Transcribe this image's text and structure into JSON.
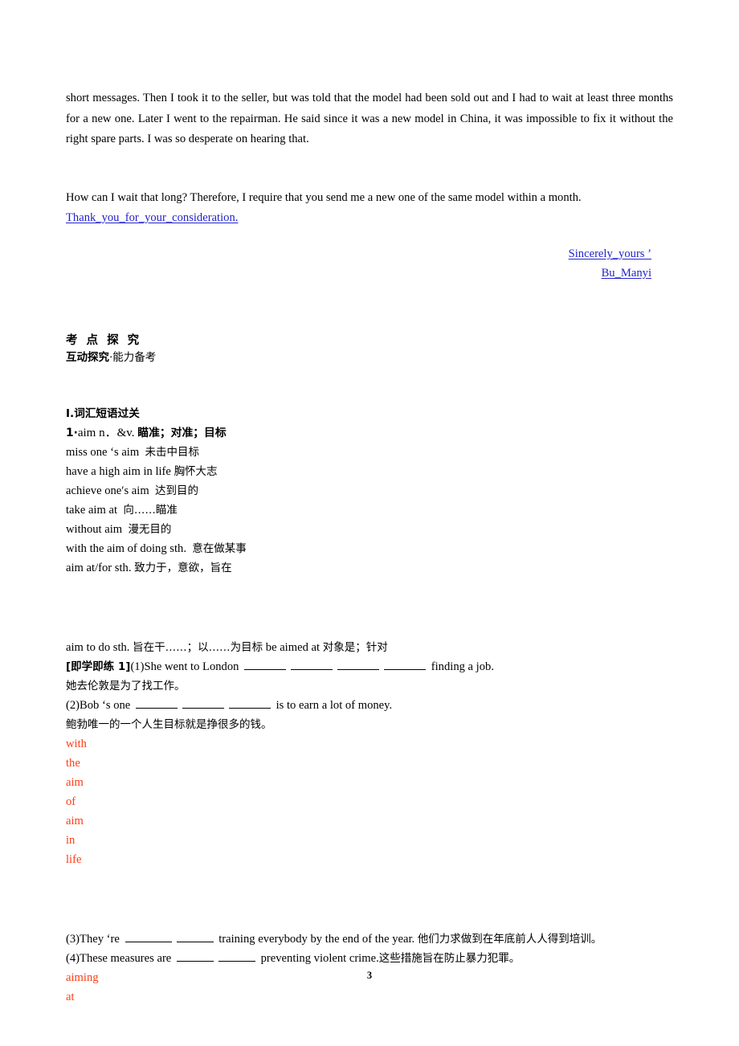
{
  "letter": {
    "paragraph1": "short messages. Then I took it to the seller, but was told that the model had been sold out and I had to wait at least three months for a new one. Later I went to the repairman. He said since it was a new model in China, it was impossible to fix it without the right spare parts. I was so desperate on hearing that.",
    "paragraph2": "How can I wait that long? Therefore, I require that you send me a new one of the same model within a month.",
    "closing_link": "Thank_you_for_your_consideration.",
    "signoff": "Sincerely_yours ’",
    "signature": "Bu_Manyi",
    "link_color": "#2222cc"
  },
  "section": {
    "title": "考 点 探 究",
    "subtitle_bold": "互动探究",
    "subtitle_regular": "·能力备考"
  },
  "vocab": {
    "heading": "Ⅰ.词汇短语过关",
    "entry_number": "1·",
    "entry_word": "aim n．&v.",
    "entry_meaning": "瞄准；对准；目标",
    "phrases": [
      {
        "en": "miss one ‘s aim",
        "cn": "未击中目标"
      },
      {
        "en": "have a high aim in life",
        "cn": "胸怀大志"
      },
      {
        "en": "achieve one′s aim",
        "cn": "达到目的"
      },
      {
        "en": "take aim at",
        "cn": "向……瞄准"
      },
      {
        "en": "without aim",
        "cn": "漫无目的"
      },
      {
        "en": "with the aim of doing sth.",
        "cn": "意在做某事"
      },
      {
        "en": "aim at/for sth.",
        "cn": "致力于，意欲，旨在"
      }
    ],
    "phrase_extra": {
      "en1": "aim to do sth.",
      "cn1": "旨在干……；以……为目标",
      "en2": "be aimed at",
      "cn2": "对象是；针对"
    }
  },
  "exercise": {
    "tag": "[即学即练 1]",
    "items": [
      {
        "number": "(1)",
        "text_before": "She went to London",
        "blanks": 4,
        "text_after": "finding a job.",
        "translation": "她去伦敦是为了找工作。"
      },
      {
        "number": "(2)",
        "text_before": "Bob ‘s one",
        "blanks": 3,
        "text_after": "is to earn a lot of money.",
        "translation": "鲍勃唯一的一个人生目标就是挣很多的钱。"
      },
      {
        "number": "(3)",
        "text_before": "They ‘re",
        "blanks": 2,
        "text_after": "training everybody by the end of the year.",
        "translation": "他们力求做到在年底前人人得到培训。"
      },
      {
        "number": "(4)",
        "text_before": "These measures are",
        "blanks": 2,
        "text_after": "preventing violent crime.",
        "translation": "这些措施旨在防止暴力犯罪。"
      }
    ],
    "answers_group1": [
      "with",
      "the",
      "aim",
      "of",
      "aim",
      "in",
      "life"
    ],
    "answers_group2": [
      "aiming",
      "at"
    ],
    "answer_color": "#ff3d14"
  },
  "footer": {
    "page_number": "3"
  }
}
